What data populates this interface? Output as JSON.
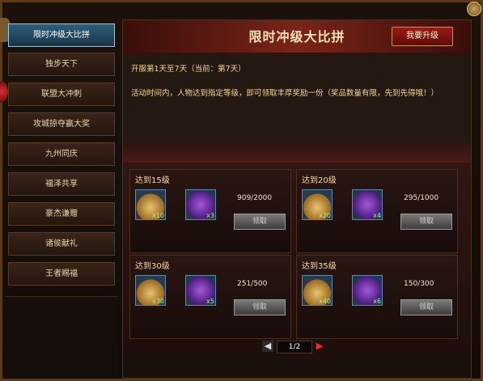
{
  "sidebar": {
    "items": [
      {
        "label": "限时冲级大比拼",
        "active": true
      },
      {
        "label": "独步天下"
      },
      {
        "label": "联盟大冲刺"
      },
      {
        "label": "攻城掠夺赢大奖"
      },
      {
        "label": "九州同庆"
      },
      {
        "label": "福泽共享"
      },
      {
        "label": "豪杰谦赠"
      },
      {
        "label": "诸侯献礼"
      },
      {
        "label": "王者赐福"
      }
    ]
  },
  "header": {
    "title": "限时冲级大比拼",
    "upgrade_button": "我要升级"
  },
  "info": {
    "dates": "开服第1天至7天（当前：第7天）",
    "description": "活动时间内，人物达到指定等级，即可领取丰厚奖励一份（奖品数量有限，先到先得哦！）"
  },
  "rewards": [
    {
      "title": "达到15级",
      "items": [
        {
          "icon": "money-bag-icon",
          "qty": "x10"
        },
        {
          "icon": "purple-book-icon",
          "qty": "x3"
        }
      ],
      "progress": "909/2000",
      "claim_label": "领取"
    },
    {
      "title": "达到20级",
      "items": [
        {
          "icon": "money-bag-icon",
          "qty": "x20"
        },
        {
          "icon": "purple-book-icon",
          "qty": "x4"
        }
      ],
      "progress": "295/1000",
      "claim_label": "领取"
    },
    {
      "title": "达到30级",
      "items": [
        {
          "icon": "money-bag-icon",
          "qty": "x30"
        },
        {
          "icon": "purple-book-icon",
          "qty": "x5"
        }
      ],
      "progress": "251/500",
      "claim_label": "领取"
    },
    {
      "title": "达到35级",
      "items": [
        {
          "icon": "money-bag-icon",
          "qty": "x40"
        },
        {
          "icon": "purple-book-icon",
          "qty": "x6"
        }
      ],
      "progress": "150/300",
      "claim_label": "领取"
    }
  ],
  "pager": {
    "label": "1/2",
    "prev": "◀",
    "next": "▶"
  }
}
